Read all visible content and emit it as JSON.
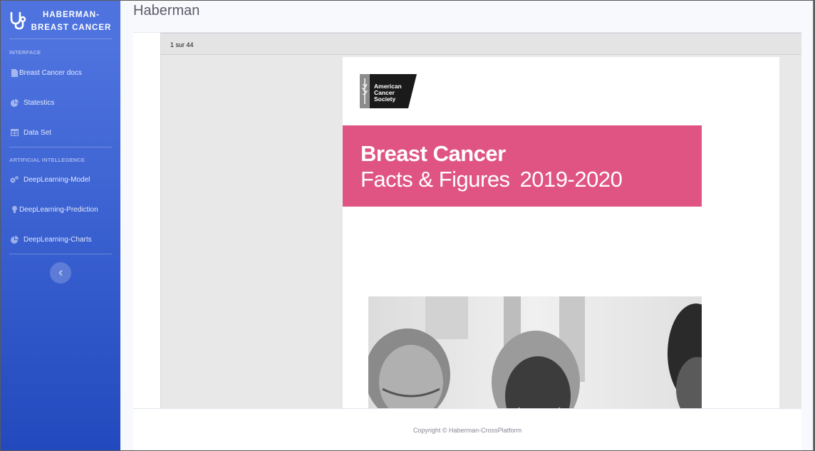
{
  "brand": {
    "line1": "HABERMAN-",
    "line2": "BREAST CANCER",
    "icon": "stethoscope-icon"
  },
  "sidebar": {
    "sections": [
      {
        "heading": "INTERFACE"
      },
      {
        "heading": "ARTIFICIAL INTELLEGENCE"
      }
    ],
    "items": [
      {
        "label": "Breast Cancer docs",
        "icon": "file-icon"
      },
      {
        "label": "Statestics",
        "icon": "pie-chart-icon"
      },
      {
        "label": "Data Set",
        "icon": "table-icon"
      },
      {
        "label": "DeepLearning-Model",
        "icon": "cogs-icon"
      },
      {
        "label": "DeepLearning-Prediction",
        "icon": "lightbulb-icon"
      },
      {
        "label": "DeepLearning-Charts",
        "icon": "pie-chart-icon"
      }
    ],
    "toggle_icon": "chevron-left-icon"
  },
  "page": {
    "title": "Haberman"
  },
  "viewer": {
    "page_counter": "1 sur 44",
    "document": {
      "logo_text": [
        "American",
        "Cancer",
        "Society"
      ],
      "title": "Breast Cancer",
      "subtitle": "Facts & Figures",
      "years": "2019-2020",
      "banner_color": "#e05484"
    }
  },
  "footer": {
    "copyright": "Copyright © Haberman-CrossPlatform"
  },
  "colors": {
    "sidebar_top": "#4e73df",
    "sidebar_bottom": "#224abe"
  }
}
